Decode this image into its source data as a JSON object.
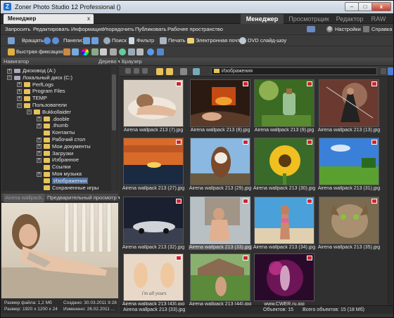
{
  "window": {
    "title": "Zoner Photo Studio 12 Professional ()",
    "minimize": "–",
    "maximize": "□",
    "close": "x"
  },
  "doc_tab": {
    "label": "Менеджер",
    "close": "x"
  },
  "module_tabs": [
    "Менеджер",
    "Просмотрщик",
    "Редактор",
    "RAW"
  ],
  "menu": {
    "items": [
      "Запросить",
      "Редактировать",
      "Информация",
      "Упорядочить",
      "Публиковать",
      "Рабочее пространство"
    ],
    "settings": "Настройки",
    "help": "Справка"
  },
  "toolbar1": {
    "rotate": "Вращать:",
    "panels": "Панели:",
    "search": "Поиск",
    "filter": "Фильтр",
    "print": "Печать",
    "email": "Электронная почта",
    "dvd": "DVD слайд-шоу"
  },
  "toolbar2": {
    "quick_fix": "Быстрая фиксация..."
  },
  "navigator": {
    "title": "Навигатор",
    "mode": "Дерево"
  },
  "tree": [
    {
      "label": "Дисковод (A:)",
      "level": 1,
      "exp": "+",
      "kind": "drive"
    },
    {
      "label": "Локальный диск (C:)",
      "level": 1,
      "exp": "−",
      "kind": "drive"
    },
    {
      "label": "PerfLogs",
      "level": 2,
      "exp": "+",
      "kind": "folder"
    },
    {
      "label": "Program Files",
      "level": 2,
      "exp": "+",
      "kind": "folder"
    },
    {
      "label": "TEMP",
      "level": 2,
      "exp": "+",
      "kind": "folder"
    },
    {
      "label": "Пользователи",
      "level": 2,
      "exp": "−",
      "kind": "folder"
    },
    {
      "label": "Bukkollaider",
      "level": 3,
      "exp": "−",
      "kind": "folder"
    },
    {
      "label": ".dooble",
      "level": 4,
      "exp": "+",
      "kind": "folder"
    },
    {
      "label": ".thumb",
      "level": 4,
      "exp": "+",
      "kind": "folder"
    },
    {
      "label": "Контакты",
      "level": 4,
      "exp": "",
      "kind": "folder"
    },
    {
      "label": "Рабочий стол",
      "level": 4,
      "exp": "+",
      "kind": "folder"
    },
    {
      "label": "Мои документы",
      "level": 4,
      "exp": "+",
      "kind": "folder"
    },
    {
      "label": "Загрузки",
      "level": 4,
      "exp": "+",
      "kind": "folder"
    },
    {
      "label": "Избранное",
      "level": 4,
      "exp": "+",
      "kind": "folder"
    },
    {
      "label": "Ссылки",
      "level": 4,
      "exp": "",
      "kind": "folder"
    },
    {
      "label": "Моя музыка",
      "level": 4,
      "exp": "+",
      "kind": "folder"
    },
    {
      "label": "Изображения",
      "level": 4,
      "exp": "",
      "kind": "folder",
      "selected": true
    },
    {
      "label": "Сохраненные игры",
      "level": 4,
      "exp": "",
      "kind": "folder"
    }
  ],
  "preview": {
    "filename": "Airena wallpack...",
    "mode": "Предварительный просмотр",
    "info": {
      "size": "Размер файла: 1,2 Мб",
      "created": "Создано: 30.03.2011 9:28",
      "dims": "Размер: 1920 x 1200 x 24",
      "modified": "Изменено: 26.02.2011 ..."
    }
  },
  "browser": {
    "title": "Браузер",
    "path": "Изображения",
    "thumbs": [
      "Airena wallpack 213 (7).jpg",
      "Airena wallpack 213 (8).jpg",
      "Airena wallpack 213 (9).jpg",
      "Airena wallpack 213 (13).jpg",
      "Airena wallpack 213 (27).jpg",
      "Airena wallpack 213 (29).jpg",
      "Airena wallpack 213 (30).jpg",
      "Airena wallpack 213 (31).jpg",
      "Airena wallpack 213 (32).jpg",
      "Airena wallpack 213 (33).jpg",
      "Airena wallpack 213 (34).jpg",
      "Airena wallpack 213 (35).jpg",
      "Airena wallpack 213 (43).jpg",
      "Airena wallpack 213 (44).jpg",
      "www.CWER.ru.jpg"
    ],
    "image_text": {
      "t13": "i'm all yours"
    },
    "selected_index": 9
  },
  "status": {
    "current": "Airena wallpack 213 (33).jpg",
    "objects": "Объектов: 15",
    "total": "Всего объектов: 15 (18 Мб)"
  },
  "colors": {
    "accent": "#4b6fa0",
    "badge": "#d0262e",
    "folder": "#e8c35a"
  }
}
